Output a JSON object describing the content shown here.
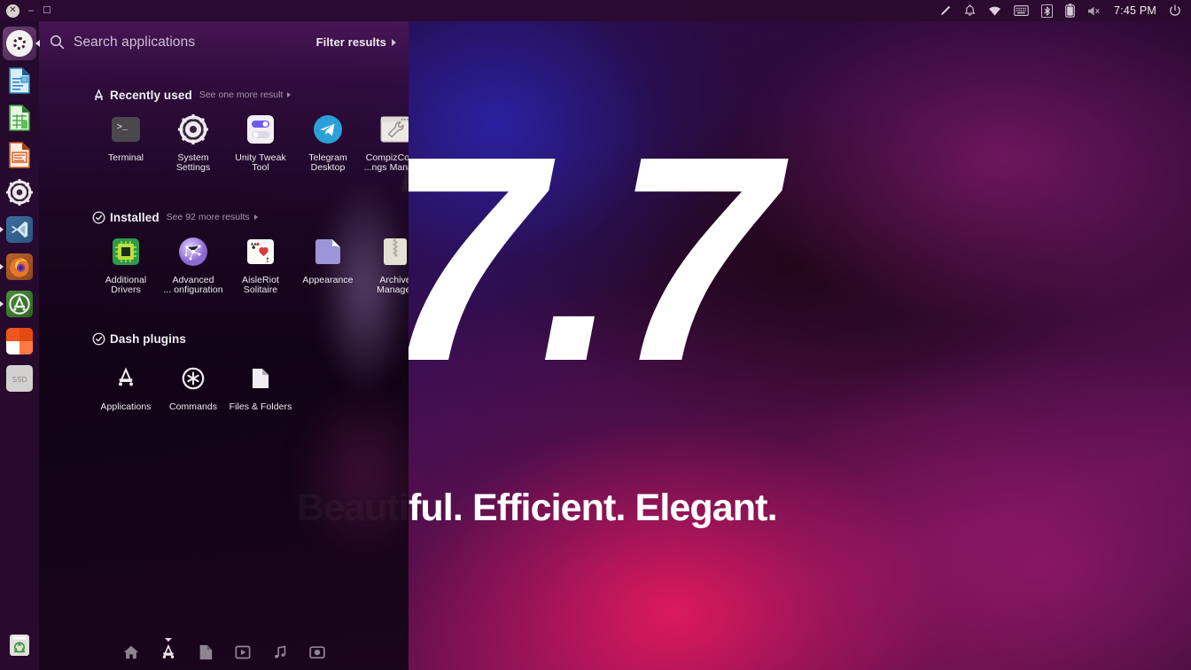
{
  "desktop": {
    "wallpaper": {
      "version_text": "7.7",
      "tagline": "Beautiful. Efficient. Elegant.",
      "base_color": "#2d0a36",
      "accent_color": "#e11c5c"
    }
  },
  "top_panel": {
    "window_controls": {
      "close_label": "✕",
      "minimize_label": "–",
      "maximize_label": "☐"
    },
    "indicators": [
      {
        "name": "pencil-icon",
        "label": "Edit"
      },
      {
        "name": "bell-icon",
        "label": "Notifications"
      },
      {
        "name": "wifi-icon",
        "label": "Network"
      },
      {
        "name": "keyboard-icon",
        "label": "Keyboard layout"
      },
      {
        "name": "bluetooth-icon",
        "label": "Bluetooth"
      },
      {
        "name": "battery-icon",
        "label": "Battery"
      },
      {
        "name": "volume-muted-icon",
        "label": "Sound muted"
      }
    ],
    "clock": "7:45 PM",
    "power_label": "Power"
  },
  "launcher": {
    "items": [
      {
        "name": "ubuntu-dash-button",
        "label": "Dash home",
        "running": false,
        "focused": true
      },
      {
        "name": "libreoffice-writer",
        "label": "LibreOffice Writer",
        "running": false,
        "focused": false
      },
      {
        "name": "libreoffice-calc",
        "label": "LibreOffice Calc",
        "running": false,
        "focused": false
      },
      {
        "name": "libreoffice-impress",
        "label": "LibreOffice Impress",
        "running": false,
        "focused": false
      },
      {
        "name": "system-settings",
        "label": "System Settings",
        "running": false,
        "focused": false
      },
      {
        "name": "visual-studio-code",
        "label": "Visual Studio Code",
        "running": true,
        "focused": false
      },
      {
        "name": "firefox",
        "label": "Firefox",
        "running": true,
        "focused": false
      },
      {
        "name": "ubuntu-software",
        "label": "Ubuntu Software",
        "running": true,
        "focused": false
      },
      {
        "name": "orange-tiles-app",
        "label": "Application",
        "running": false,
        "focused": false
      },
      {
        "name": "ssd-drive",
        "label": "SSD",
        "running": false,
        "focused": false
      }
    ],
    "trash": {
      "name": "trash-icon",
      "label": "Trash"
    }
  },
  "dash": {
    "search": {
      "placeholder": "Search applications",
      "value": ""
    },
    "filter_label": "Filter results",
    "sections": [
      {
        "id": "recently-used",
        "icon": "applications-lens-icon",
        "title": "Recently used",
        "more_label": "See one more result",
        "tiles": [
          {
            "icon": "terminal-icon",
            "label": "Terminal"
          },
          {
            "icon": "system-settings-icon",
            "label": "System\nSettings"
          },
          {
            "icon": "unity-tweak-icon",
            "label": "Unity Tweak\nTool"
          },
          {
            "icon": "telegram-icon",
            "label": "Telegram\nDesktop"
          },
          {
            "icon": "compizconfig-icon",
            "label": "CompizConfig\n...ngs Manager"
          }
        ]
      },
      {
        "id": "installed",
        "icon": "check-circle-icon",
        "title": "Installed",
        "more_label": "See 92 more results",
        "tiles": [
          {
            "icon": "additional-drivers-icon",
            "label": "Additional\nDrivers"
          },
          {
            "icon": "advanced-config-icon",
            "label": "Advanced\n... onfiguration"
          },
          {
            "icon": "aisleriot-icon",
            "label": "AisleRiot\nSolitaire"
          },
          {
            "icon": "appearance-icon",
            "label": "Appearance"
          },
          {
            "icon": "archive-manager-icon",
            "label": "Archive\nManager"
          }
        ]
      },
      {
        "id": "dash-plugins",
        "icon": "check-circle-icon",
        "title": "Dash plugins",
        "more_label": "",
        "tiles": [
          {
            "icon": "applications-scope-icon",
            "label": "Applications"
          },
          {
            "icon": "commands-scope-icon",
            "label": "Commands"
          },
          {
            "icon": "files-scope-icon",
            "label": "Files & Folders"
          }
        ]
      }
    ],
    "bottom_bar": [
      {
        "name": "lens-home",
        "label": "Home",
        "active": false
      },
      {
        "name": "lens-applications",
        "label": "Applications",
        "active": true
      },
      {
        "name": "lens-files",
        "label": "Files",
        "active": false
      },
      {
        "name": "lens-video",
        "label": "Video",
        "active": false
      },
      {
        "name": "lens-music",
        "label": "Music",
        "active": false
      },
      {
        "name": "lens-photos",
        "label": "Photos",
        "active": false
      }
    ]
  }
}
